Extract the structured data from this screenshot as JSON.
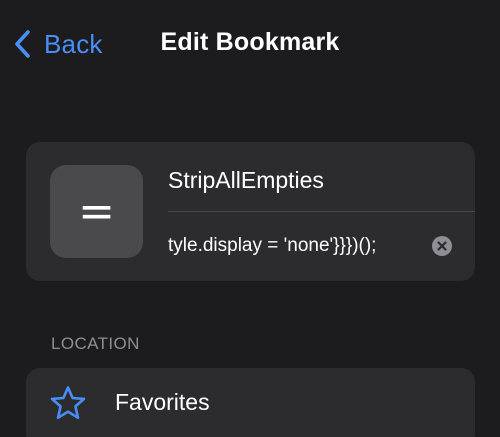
{
  "nav": {
    "back_label": "Back",
    "back_icon": "chevron-left-icon",
    "title": "Edit Bookmark"
  },
  "bookmark": {
    "thumbnail_glyph": "=",
    "name": "StripAllEmpties",
    "url": "tyle.display = 'none'}}})();",
    "clear_icon": "clear-x-icon"
  },
  "location": {
    "section_header": "LOCATION",
    "icon": "star-icon",
    "value": "Favorites"
  },
  "colors": {
    "background": "#1c1c1e",
    "card": "#2c2c2e",
    "accent": "#4a8ff7",
    "secondary_text": "#8e8e93"
  }
}
